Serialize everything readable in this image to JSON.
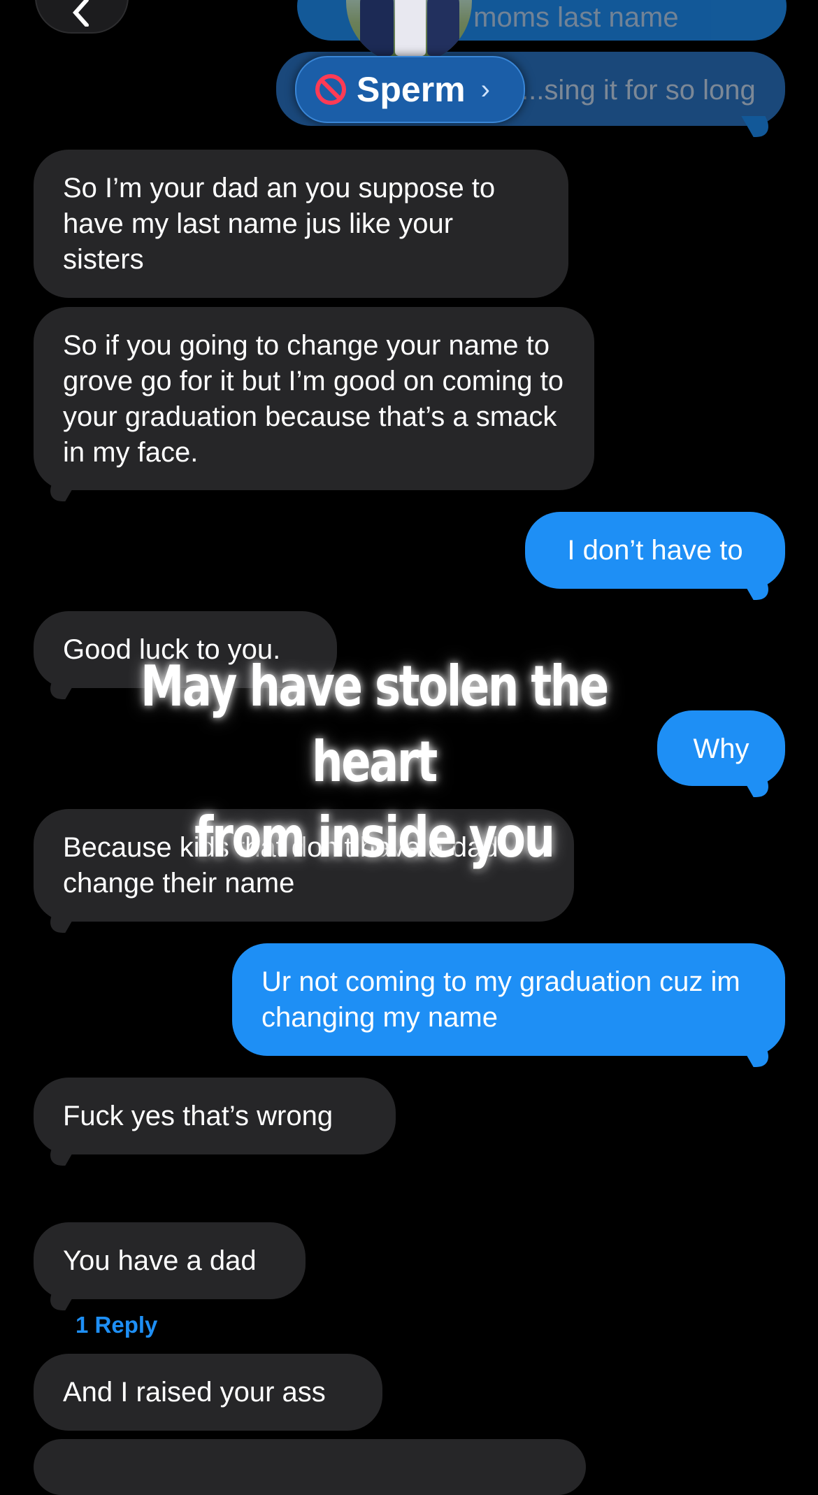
{
  "contact": {
    "name": "Sperm",
    "blocked_icon": "no-entry-icon",
    "chevron": "›"
  },
  "messages": [
    {
      "dir": "out",
      "text": "...ms moms last name",
      "faded": true
    },
    {
      "dir": "out",
      "text": "...sing it for so long",
      "faded": true
    },
    {
      "dir": "in",
      "text": "So I’m your dad an you suppose to have my last name jus like your sisters"
    },
    {
      "dir": "in",
      "text": "So if you going to change your name to grove go for it but I’m good on coming to your graduation because that’s a smack in my face."
    },
    {
      "dir": "out",
      "text": "I don’t have to"
    },
    {
      "dir": "in",
      "text": "Good luck to you."
    },
    {
      "dir": "out",
      "text": "Why"
    },
    {
      "dir": "in",
      "text": "Because kids that don’t have a dad change their name"
    },
    {
      "dir": "out",
      "text": "Ur not coming to my graduation cuz im changing my name"
    },
    {
      "dir": "in",
      "text": "Fuck yes that’s wrong"
    },
    {
      "dir": "in",
      "text": "You have a dad"
    },
    {
      "dir": "in",
      "text": "And I raised your ass"
    }
  ],
  "reply_link": "1 Reply",
  "overlay_caption": {
    "line1": "May have stolen the heart",
    "line2": "from inside you"
  },
  "colors": {
    "incoming": "#262628",
    "outgoing": "#1e8ff5",
    "background": "#000000"
  }
}
